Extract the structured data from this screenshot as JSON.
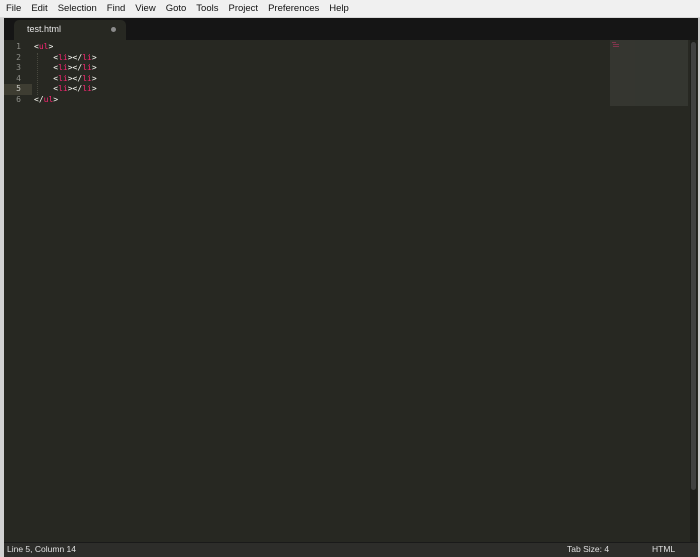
{
  "menubar": {
    "items": [
      "File",
      "Edit",
      "Selection",
      "Find",
      "View",
      "Goto",
      "Tools",
      "Project",
      "Preferences",
      "Help"
    ]
  },
  "tabs": [
    {
      "label": "test.html",
      "modified_indicator": "dot-icon"
    }
  ],
  "editor": {
    "line_numbers": [
      "1",
      "2",
      "3",
      "4",
      "5",
      "6"
    ],
    "active_line": 5,
    "lines": [
      {
        "indent": "",
        "open": "<",
        "tag": "ul",
        "close": ">",
        "end_open": "",
        "end_tag": "",
        "end_close": ""
      },
      {
        "indent": "    ",
        "open": "<",
        "tag": "li",
        "close": "></",
        "end_tag": "li",
        "end_close": ">"
      },
      {
        "indent": "    ",
        "open": "<",
        "tag": "li",
        "close": "></",
        "end_tag": "li",
        "end_close": ">"
      },
      {
        "indent": "    ",
        "open": "<",
        "tag": "li",
        "close": "></",
        "end_tag": "li",
        "end_close": ">"
      },
      {
        "indent": "    ",
        "open": "<",
        "tag": "li",
        "close": "></",
        "end_tag": "li",
        "end_close": ">"
      },
      {
        "indent": "",
        "open": "</",
        "tag": "ul",
        "close": ">",
        "end_tag": "",
        "end_close": ""
      }
    ],
    "colors": {
      "background": "#272822",
      "tag": "#f92672",
      "punctuation": "#f8f8f2",
      "line_number": "#8f908a"
    }
  },
  "statusbar": {
    "position": "Line 5, Column 14",
    "tab_size": "Tab Size: 4",
    "syntax": "HTML"
  }
}
